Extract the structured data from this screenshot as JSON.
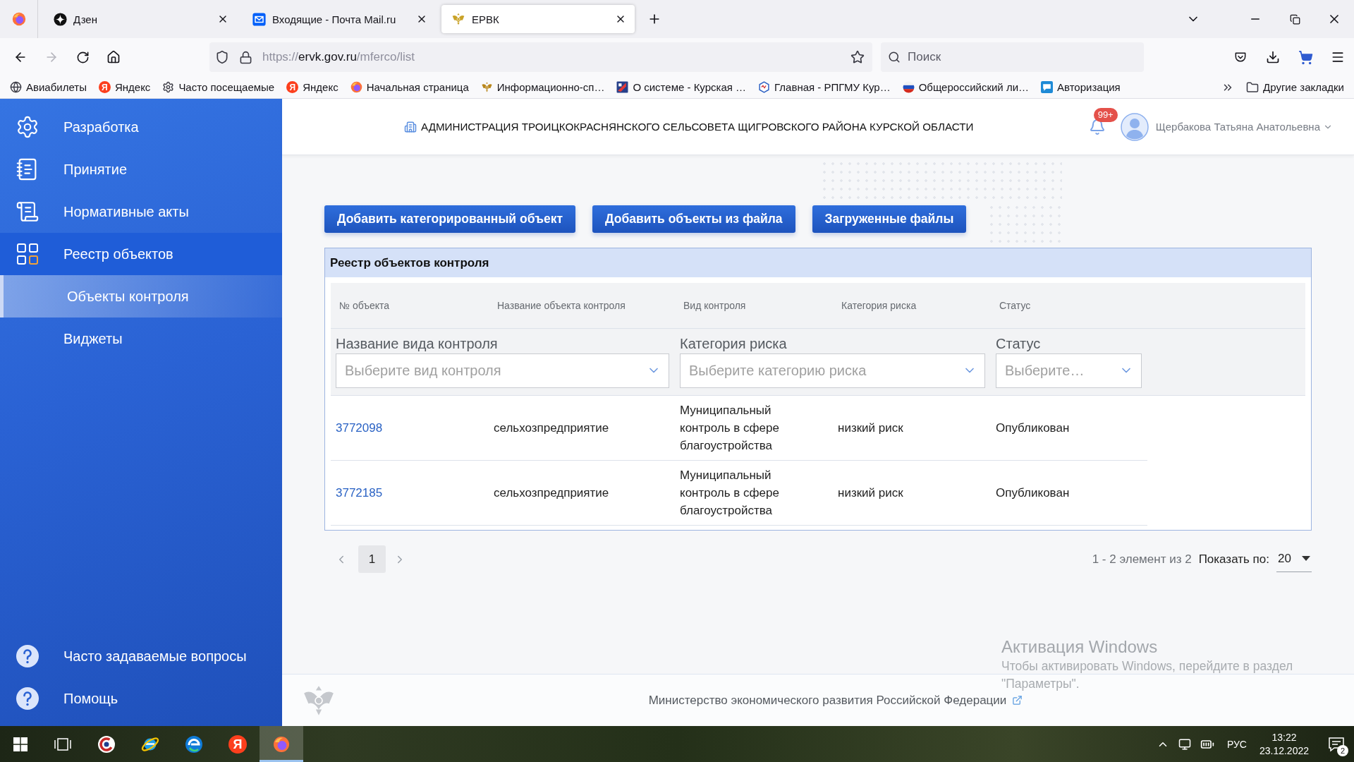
{
  "browser": {
    "tabs": [
      {
        "title": "Дзен",
        "selected": false
      },
      {
        "title": "Входящие - Почта Mail.ru",
        "selected": false
      },
      {
        "title": "ЕРВК",
        "selected": true
      }
    ],
    "back": {
      "disabled": false
    },
    "forward": {
      "disabled": true
    },
    "address": {
      "scheme": "https://",
      "domain": "ervk.gov.ru",
      "path": "/mferco/list"
    },
    "search": {
      "placeholder": "Поиск"
    },
    "bookmarks": [
      {
        "label": "Авиабилеты"
      },
      {
        "label": "Яндекс",
        "icon_glyph": "Я"
      },
      {
        "label": "Часто посещаемые"
      },
      {
        "label": "Яндекс",
        "icon_glyph": "Я"
      },
      {
        "label": "Начальная страница"
      },
      {
        "label": "Информационно-сп…"
      },
      {
        "label": "О системе - Курская …"
      },
      {
        "label": "Главная - РПГМУ Кур…"
      },
      {
        "label": "Общероссийский ли…"
      },
      {
        "label": "Авторизация"
      }
    ],
    "other_bookmarks": "Другие закладки"
  },
  "sidebar": {
    "items": [
      {
        "label": "Разработка",
        "selected": false
      },
      {
        "label": "Принятие",
        "selected": false
      },
      {
        "label": "Нормативные акты",
        "selected": false
      },
      {
        "label": "Реестр объектов",
        "selected": true,
        "children": [
          {
            "label": "Объекты контроля",
            "selected": true
          },
          {
            "label": "Виджеты",
            "selected": false
          }
        ]
      }
    ],
    "bottom_items": [
      {
        "label": "Часто задаваемые вопросы"
      },
      {
        "label": "Помощь"
      }
    ]
  },
  "header": {
    "organization": "АДМИНИСТРАЦИЯ ТРОИЦКОКРАСНЯНСКОГО СЕЛЬСОВЕТА ЩИГРОВСКОГО РАЙОНА КУРСКОЙ ОБЛАСТИ",
    "notification_count": "99+",
    "user_name": "Щербакова Татьяна Анатольевна"
  },
  "actions": [
    {
      "label": "Добавить категорированный объект"
    },
    {
      "label": "Добавить объекты из файла"
    },
    {
      "label": "Загруженные файлы"
    }
  ],
  "registry": {
    "title": "Реестр объектов контроля",
    "columns": [
      "№ объекта",
      "Название объекта контроля",
      "Вид контроля",
      "Категория риска",
      "Статус"
    ],
    "filters": [
      {
        "label": "Название вида контроля",
        "placeholder": "Выберите вид контроля"
      },
      {
        "label": "Категория риска",
        "placeholder": "Выберите категорию риска"
      },
      {
        "label": "Статус",
        "placeholder": "Выберите…"
      }
    ],
    "rows": [
      {
        "number": "3772098",
        "name": "сельхозпредприятие",
        "control_type": "Муниципальный контроль в сфере благоустройства",
        "risk_category": "низкий риск",
        "status": "Опубликован"
      },
      {
        "number": "3772185",
        "name": "сельхозпредприятие",
        "control_type": "Муниципальный контроль в сфере благоустройства",
        "risk_category": "низкий риск",
        "status": "Опубликован"
      }
    ]
  },
  "pagination": {
    "pages": [
      {
        "label": "1",
        "selected": true
      }
    ],
    "summary": "1 - 2 элемент из 2",
    "page_size_label": "Показать по:",
    "page_size": "20"
  },
  "footer": {
    "text": "Министерство экономического развития Российской Федерации"
  },
  "windows_activation": {
    "title": "Активация Windows",
    "text": "Чтобы активировать Windows, перейдите в раздел \"Параметры\"."
  },
  "taskbar": {
    "apps": [
      {
        "selected": false
      },
      {
        "selected": false
      },
      {
        "selected": false
      },
      {
        "selected": false,
        "icon_glyph": "Я"
      },
      {
        "selected": true
      }
    ],
    "language": "РУС",
    "time": "13:22",
    "date": "23.12.2022",
    "notification_count": "2"
  }
}
